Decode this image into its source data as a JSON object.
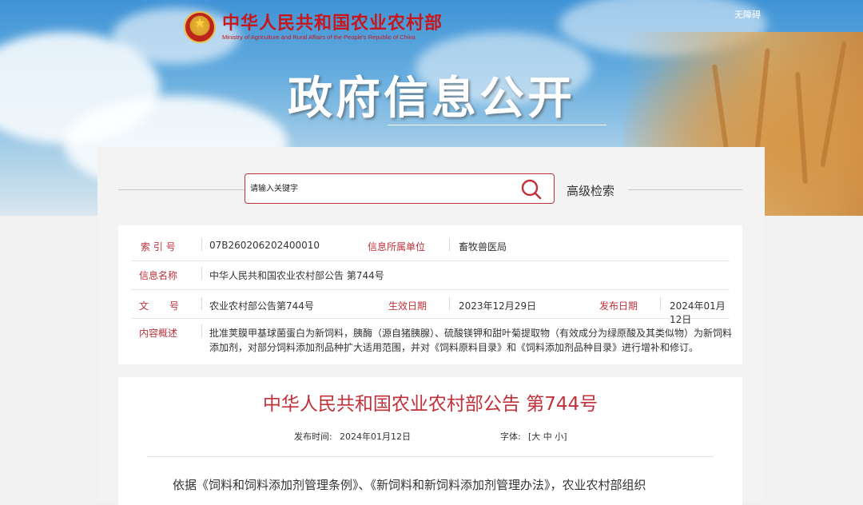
{
  "header": {
    "ministry_cn": "中华人民共和国农业农村部",
    "ministry_en": "Ministry of Agriculture and Rural Affairs of the People's Republic of China",
    "accessibility": "无障碍",
    "title": "政府信息公开"
  },
  "search": {
    "placeholder": "请输入关键字",
    "advanced_label": "高级检索"
  },
  "info": {
    "index_label": "索 引 号",
    "index_value": "07B260206202400010",
    "unit_label": "信息所属单位",
    "unit_value": "畜牧兽医局",
    "name_label": "信息名称",
    "name_value": "中华人民共和国农业农村部公告 第744号",
    "doc_label": "文 号",
    "doc_value": "农业农村部公告第744号",
    "effective_label": "生效日期",
    "effective_value": "2023年12月29日",
    "publish_label": "发布日期",
    "publish_value": "2024年01月12日",
    "summary_label": "内容概述",
    "summary_line1": "批准荚膜甲基球菌蛋白为新饲料，胰酶（源自猪胰腺）、硫酸镁钾和甜叶菊提取物（有效成分为绿原酸及其类似物）为新饲料",
    "summary_line2": "添加剂，对部分饲料添加剂品种扩大适用范围，并对《饲料原料目录》和《饲料添加剂品种目录》进行增补和修订。"
  },
  "article": {
    "title": "中华人民共和国农业农村部公告 第744号",
    "date_label": "发布时间:",
    "date_value": "2024年01月12日",
    "font_label": "字体:",
    "font_open": "[",
    "font_large": "大",
    "font_medium": "中",
    "font_small": "小",
    "font_close": "]",
    "body_start": "依据《饲料和饲料添加剂管理条例》、《新饲料和新饲料添加剂管理办法》，农业农村部组织"
  },
  "colors": {
    "accent_red": "#c0313a",
    "banner_blue": "#4a98d8"
  }
}
